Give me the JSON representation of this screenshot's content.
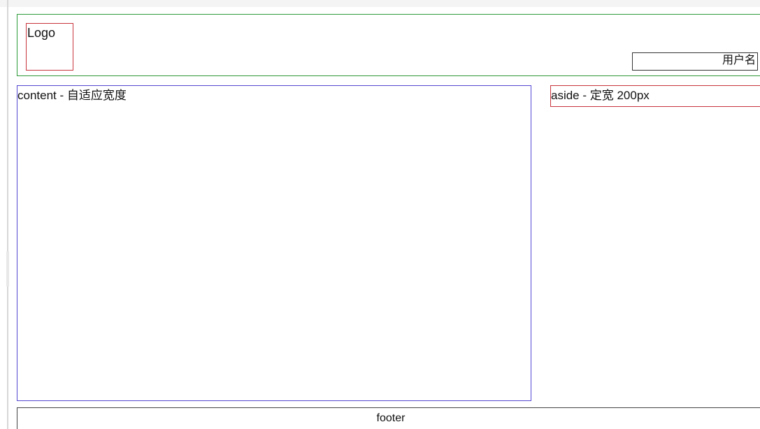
{
  "header": {
    "logo_label": "Logo",
    "username_label": "用户名"
  },
  "main": {
    "content_label": "content - 自适应宽度",
    "aside_label": "aside - 定宽 200px"
  },
  "footer": {
    "label": "footer"
  },
  "colors": {
    "header_border": "#2e9a3a",
    "logo_border": "#c8343d",
    "content_border": "#5346d1",
    "aside_border": "#c8343d",
    "footer_border": "#444444"
  }
}
